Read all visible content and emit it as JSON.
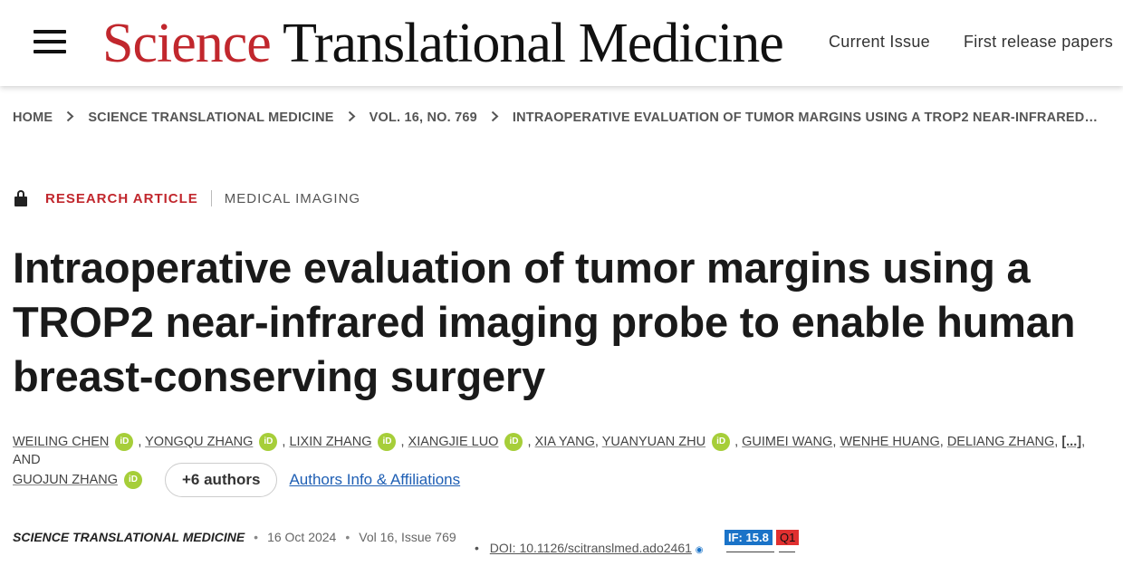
{
  "header": {
    "logo_science": "Science",
    "logo_rest": "Translational Medicine",
    "nav": [
      "Current Issue",
      "First release papers"
    ]
  },
  "breadcrumb": [
    "HOME",
    "SCIENCE TRANSLATIONAL MEDICINE",
    "VOL. 16, NO. 769",
    "INTRAOPERATIVE EVALUATION OF TUMOR MARGINS USING A TROP2 NEAR-INFRARED…"
  ],
  "article": {
    "type": "RESEARCH ARTICLE",
    "subject": "MEDICAL IMAGING",
    "title": "Intraoperative evaluation of tumor margins using a TROP2 near-infrared imaging probe to enable human breast-conserving surgery",
    "authors": {
      "list": [
        "WEILING CHEN",
        "YONGQU ZHANG",
        "LIXIN ZHANG",
        "XIANGJIE LUO",
        "XIA YANG",
        "YUANYUAN ZHU",
        "GUIMEI WANG",
        "WENHE HUANG",
        "DELIANG ZHANG",
        "GUOJUN ZHANG"
      ],
      "orcid_label": "iD",
      "ellipsis": "[...]",
      "and": ", AND",
      "more_button": "+6 authors",
      "affiliations_link": "Authors Info & Affiliations"
    },
    "citation": {
      "journal": "SCIENCE TRANSLATIONAL MEDICINE",
      "date": "16 Oct 2024",
      "volume": "Vol 16, Issue 769",
      "doi": "DOI: 10.1126/scitranslmed.ado2461",
      "impact_factor": "IF: 15.8",
      "quartile": "Q1"
    }
  },
  "share_icons": [
    "linkedin-icon",
    "reddit-icon",
    "wechat-icon",
    "email-icon"
  ],
  "colors": {
    "brand_red": "#c1272d",
    "link_blue": "#1f5fb4",
    "orcid_green": "#a6ce39",
    "if_blue": "#1a73c8",
    "q_red": "#e03030"
  }
}
